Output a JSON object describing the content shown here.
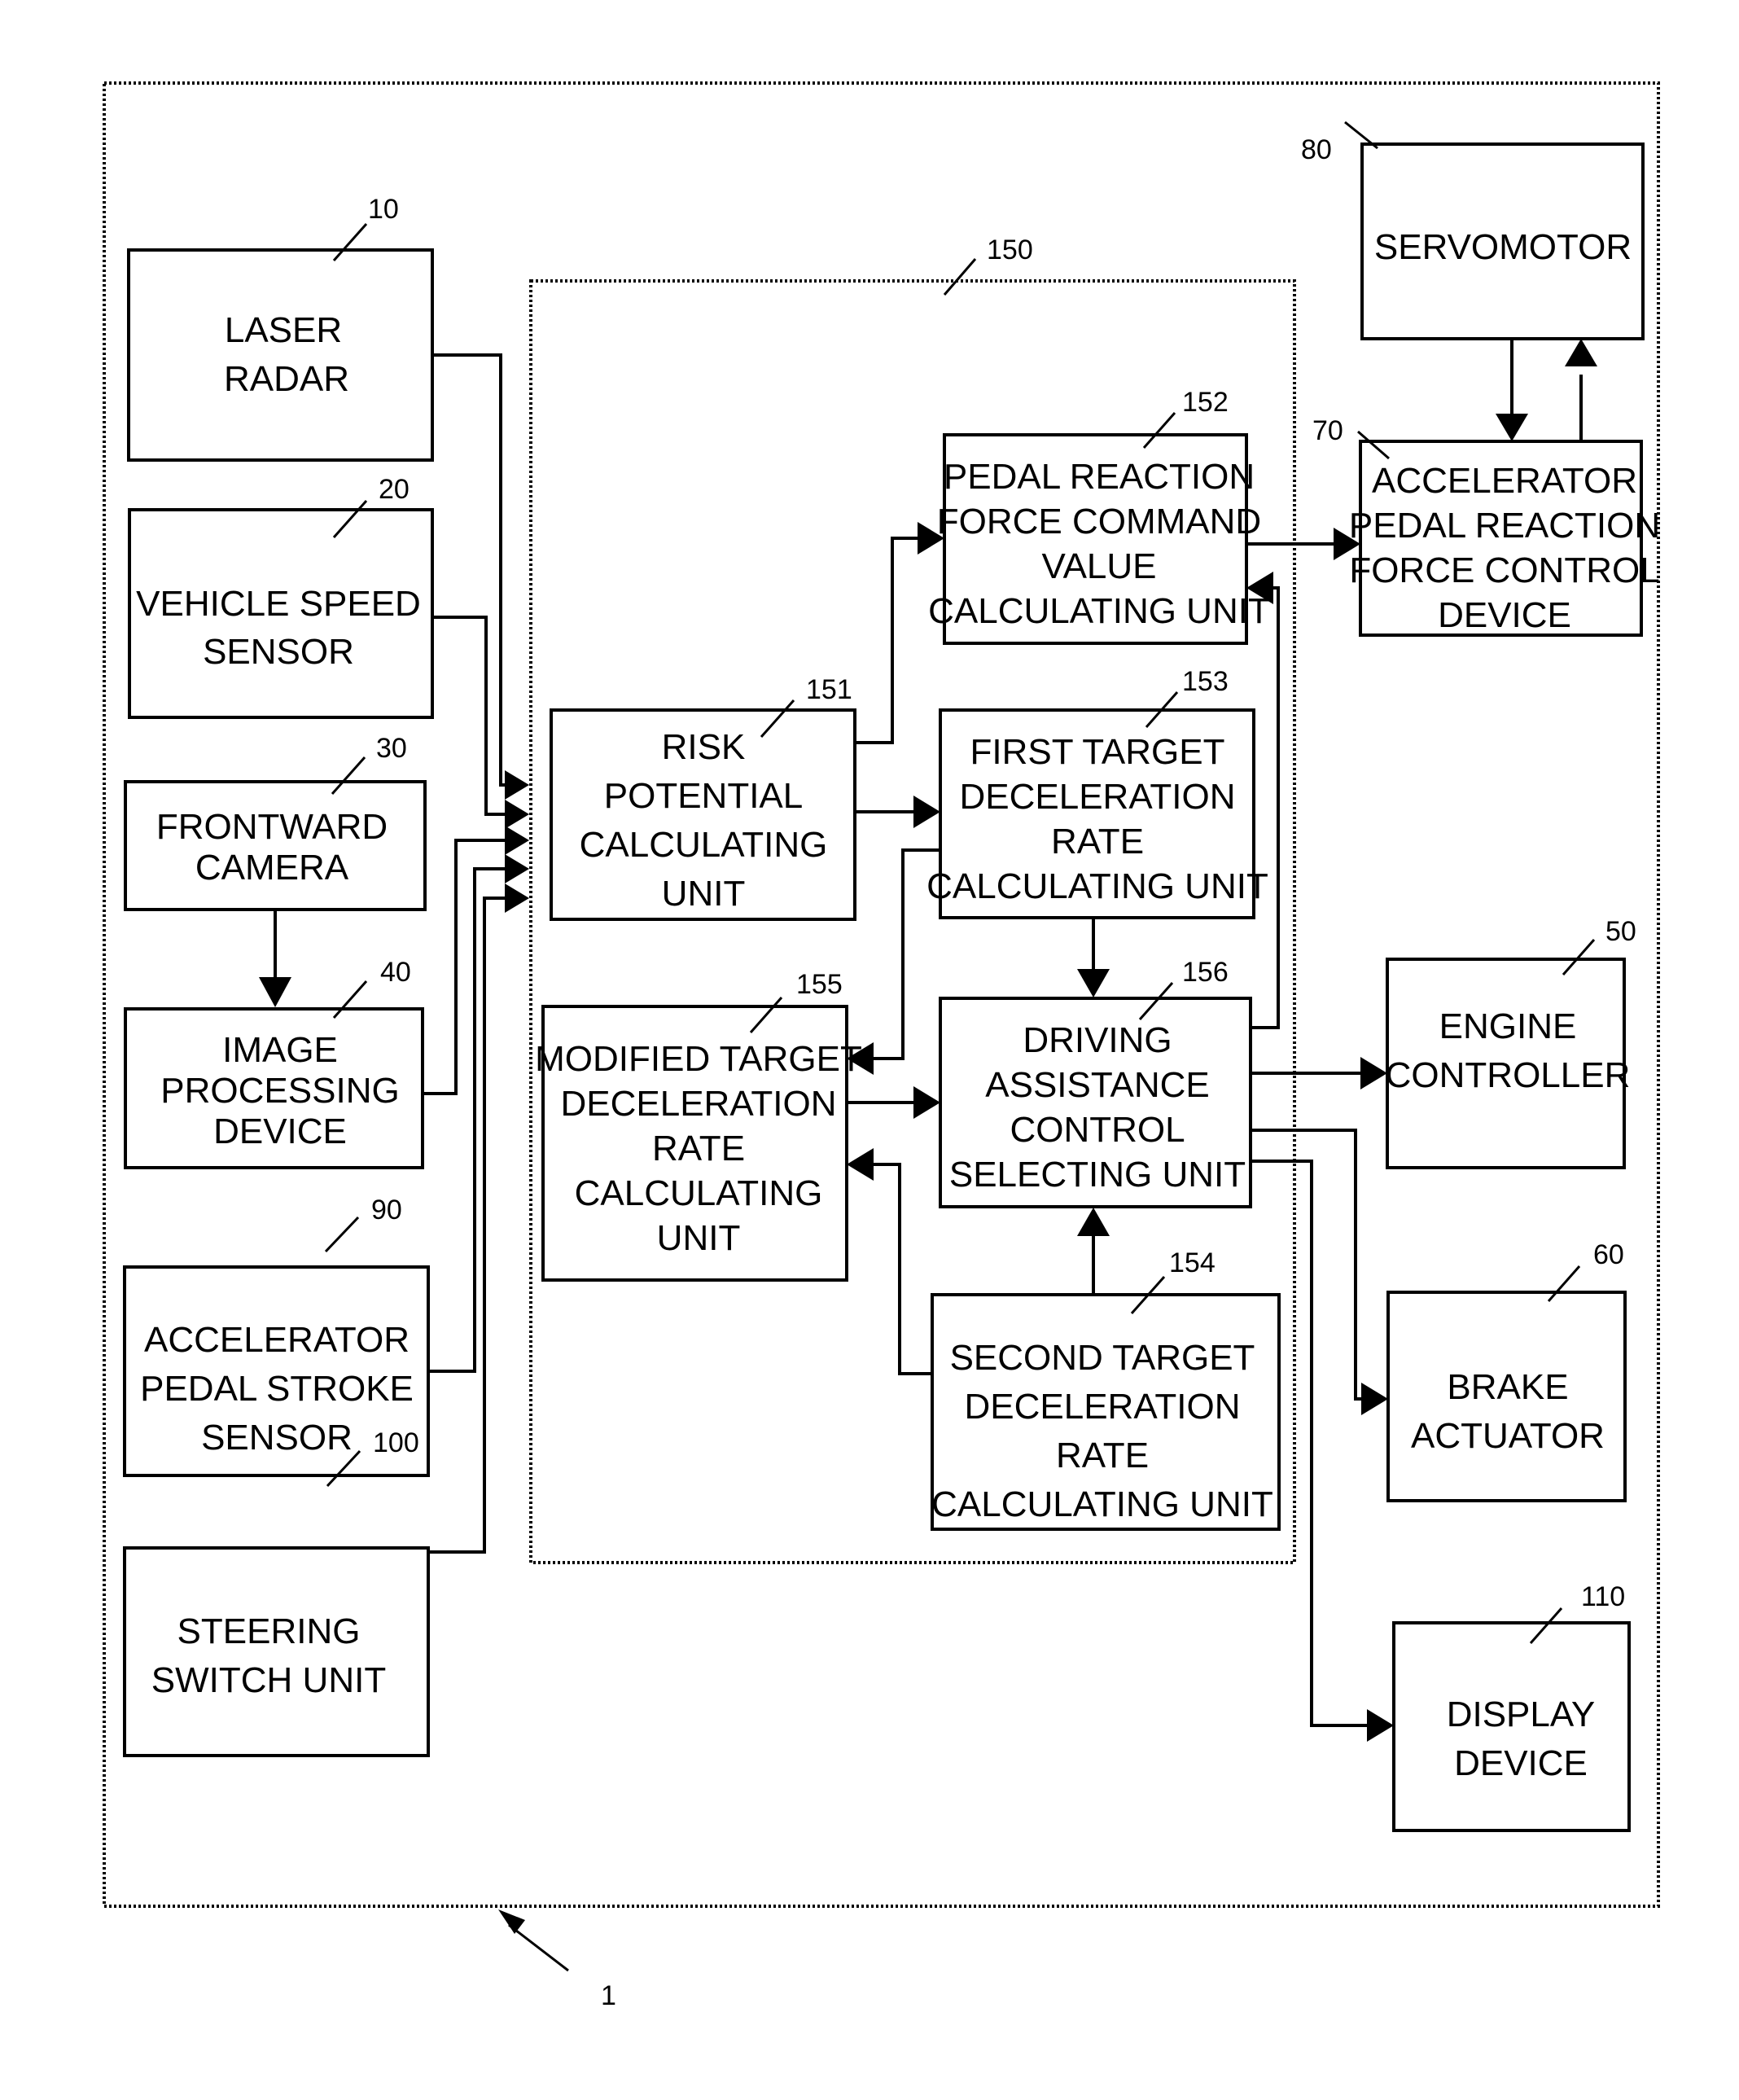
{
  "diagram": {
    "system_ref": "1",
    "controller_ref": "150",
    "blocks": {
      "laser_radar": {
        "ref": "10",
        "lines": [
          "LASER",
          "RADAR"
        ]
      },
      "vehicle_speed_sensor": {
        "ref": "20",
        "lines": [
          "VEHICLE SPEED",
          "SENSOR"
        ]
      },
      "frontward_camera": {
        "ref": "30",
        "lines": [
          "FRONTWARD",
          "CAMERA"
        ]
      },
      "image_processing_device": {
        "ref": "40",
        "lines": [
          "IMAGE",
          "PROCESSING",
          "DEVICE"
        ]
      },
      "accelerator_pedal_stroke_sensor": {
        "ref": "90",
        "lines": [
          "ACCELERATOR",
          "PEDAL STROKE",
          "SENSOR"
        ]
      },
      "steering_switch_unit": {
        "ref": "100",
        "lines": [
          "STEERING",
          "SWITCH UNIT"
        ]
      },
      "risk_potential_calculating_unit": {
        "ref": "151",
        "lines": [
          "RISK",
          "POTENTIAL",
          "CALCULATING",
          "UNIT"
        ]
      },
      "pedal_reaction_force_command_value_calculating_unit": {
        "ref": "152",
        "lines": [
          "PEDAL REACTION",
          "FORCE COMMAND",
          "VALUE",
          "CALCULATING UNIT"
        ]
      },
      "first_target_deceleration_rate_calculating_unit": {
        "ref": "153",
        "lines": [
          "FIRST TARGET",
          "DECELERATION",
          "RATE",
          "CALCULATING UNIT"
        ]
      },
      "second_target_deceleration_rate_calculating_unit": {
        "ref": "154",
        "lines": [
          "SECOND TARGET",
          "DECELERATION",
          "RATE",
          "CALCULATING UNIT"
        ]
      },
      "modified_target_deceleration_rate_calculating_unit": {
        "ref": "155",
        "lines": [
          "MODIFIED TARGET",
          "DECELERATION",
          "RATE",
          "CALCULATING",
          "UNIT"
        ]
      },
      "driving_assistance_control_selecting_unit": {
        "ref": "156",
        "lines": [
          "DRIVING",
          "ASSISTANCE",
          "CONTROL",
          "SELECTING UNIT"
        ]
      },
      "servomotor": {
        "ref": "80",
        "lines": [
          "SERVOMOTOR"
        ]
      },
      "accelerator_pedal_reaction_force_control_device": {
        "ref": "70",
        "lines": [
          "ACCELERATOR",
          "PEDAL REACTION",
          "FORCE CONTROL",
          "DEVICE"
        ]
      },
      "engine_controller": {
        "ref": "50",
        "lines": [
          "ENGINE",
          "CONTROLLER"
        ]
      },
      "brake_actuator": {
        "ref": "60",
        "lines": [
          "BRAKE",
          "ACTUATOR"
        ]
      },
      "display_device": {
        "ref": "110",
        "lines": [
          "DISPLAY",
          "DEVICE"
        ]
      }
    }
  }
}
